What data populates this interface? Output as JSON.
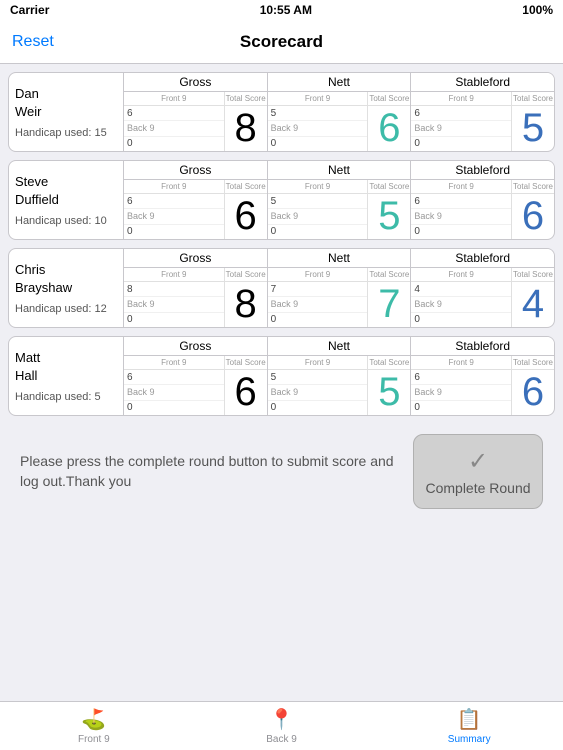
{
  "statusBar": {
    "carrier": "Carrier",
    "wifi": "▾",
    "time": "10:55 AM",
    "battery": "100%"
  },
  "navBar": {
    "title": "Scorecard",
    "resetLabel": "Reset"
  },
  "players": [
    {
      "firstName": "Dan",
      "lastName": "Weir",
      "handicap": "Handicap used: 15",
      "gross": {
        "title": "Gross",
        "frontLabel": "Front 9",
        "frontVal": "6",
        "backLabel": "Back 9",
        "backVal": "0",
        "totalLabel": "Total Score",
        "totalVal": "8",
        "totalColor": "black"
      },
      "nett": {
        "title": "Nett",
        "frontLabel": "Front 9",
        "frontVal": "5",
        "backLabel": "Back 9",
        "backVal": "0",
        "totalLabel": "Total Score",
        "totalVal": "6",
        "totalColor": "teal"
      },
      "stableford": {
        "title": "Stableford",
        "frontLabel": "Front 9",
        "frontVal": "6",
        "backLabel": "Back 9",
        "backVal": "0",
        "totalLabel": "Total Score",
        "totalVal": "5",
        "totalColor": "blue"
      }
    },
    {
      "firstName": "Steve",
      "lastName": "Duffield",
      "handicap": "Handicap used: 10",
      "gross": {
        "title": "Gross",
        "frontLabel": "Front 9",
        "frontVal": "6",
        "backLabel": "Back 9",
        "backVal": "0",
        "totalLabel": "Total Score",
        "totalVal": "6",
        "totalColor": "black"
      },
      "nett": {
        "title": "Nett",
        "frontLabel": "Front 9",
        "frontVal": "5",
        "backLabel": "Back 9",
        "backVal": "0",
        "totalLabel": "Total Score",
        "totalVal": "5",
        "totalColor": "teal"
      },
      "stableford": {
        "title": "Stableford",
        "frontLabel": "Front 9",
        "frontVal": "6",
        "backLabel": "Back 9",
        "backVal": "0",
        "totalLabel": "Total Score",
        "totalVal": "6",
        "totalColor": "blue"
      }
    },
    {
      "firstName": "Chris",
      "lastName": "Brayshaw",
      "handicap": "Handicap used: 12",
      "gross": {
        "title": "Gross",
        "frontLabel": "Front 9",
        "frontVal": "8",
        "backLabel": "Back 9",
        "backVal": "0",
        "totalLabel": "Total Score",
        "totalVal": "8",
        "totalColor": "black"
      },
      "nett": {
        "title": "Nett",
        "frontLabel": "Front 9",
        "frontVal": "7",
        "backLabel": "Back 9",
        "backVal": "0",
        "totalLabel": "Total Score",
        "totalVal": "7",
        "totalColor": "teal"
      },
      "stableford": {
        "title": "Stableford",
        "frontLabel": "Front 9",
        "frontVal": "4",
        "backLabel": "Back 9",
        "backVal": "0",
        "totalLabel": "Total Score",
        "totalVal": "4",
        "totalColor": "blue"
      }
    },
    {
      "firstName": "Matt",
      "lastName": "Hall",
      "handicap": "Handicap used: 5",
      "gross": {
        "title": "Gross",
        "frontLabel": "Front 9",
        "frontVal": "6",
        "backLabel": "Back 9",
        "backVal": "0",
        "totalLabel": "Total Score",
        "totalVal": "6",
        "totalColor": "black"
      },
      "nett": {
        "title": "Nett",
        "frontLabel": "Front 9",
        "frontVal": "5",
        "backLabel": "Back 9",
        "backVal": "0",
        "totalLabel": "Total Score",
        "totalVal": "5",
        "totalColor": "teal"
      },
      "stableford": {
        "title": "Stableford",
        "frontLabel": "Front 9",
        "frontVal": "6",
        "backLabel": "Back 9",
        "backVal": "0",
        "totalLabel": "Total Score",
        "totalVal": "6",
        "totalColor": "blue"
      }
    }
  ],
  "bottomMessage": "Please press the complete round button to submit score and log out.Thank you",
  "completeRoundLabel": "Complete Round",
  "tabs": [
    {
      "label": "Front 9",
      "icon": "⛳",
      "active": false
    },
    {
      "label": "Back 9",
      "icon": "📍",
      "active": false
    },
    {
      "label": "Summary",
      "icon": "📋",
      "active": true
    }
  ]
}
